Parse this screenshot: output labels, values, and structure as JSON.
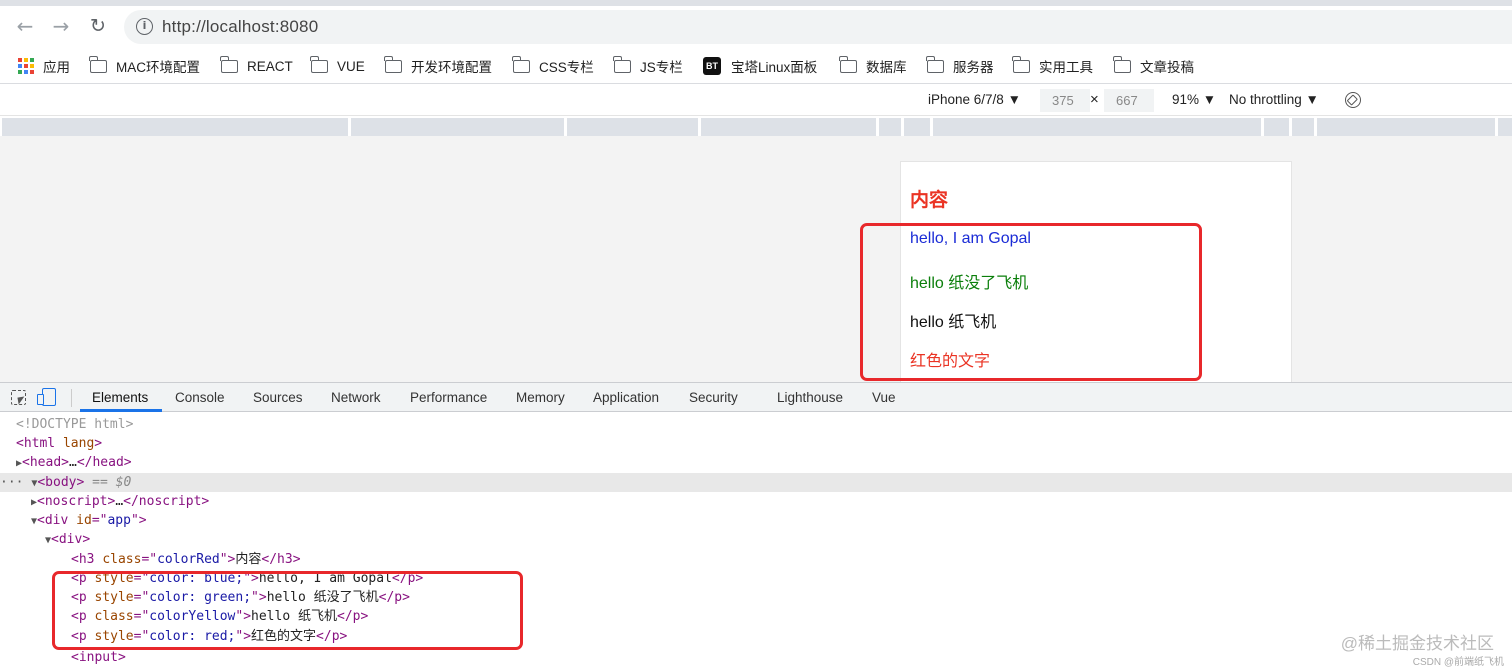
{
  "browser": {
    "url": "http://localhost:8080",
    "bookmarks": [
      {
        "label": "应用",
        "icon": "apps-grid-icon"
      },
      {
        "label": "MAC环境配置",
        "icon": "folder-icon"
      },
      {
        "label": "REACT",
        "icon": "folder-icon"
      },
      {
        "label": "VUE",
        "icon": "folder-icon"
      },
      {
        "label": "开发环境配置",
        "icon": "folder-icon"
      },
      {
        "label": "CSS专栏",
        "icon": "folder-icon"
      },
      {
        "label": "JS专栏",
        "icon": "folder-icon"
      },
      {
        "label": "宝塔Linux面板",
        "icon": "bt-icon",
        "badge": "BT"
      },
      {
        "label": "数据库",
        "icon": "folder-icon"
      },
      {
        "label": "服务器",
        "icon": "folder-icon"
      },
      {
        "label": "实用工具",
        "icon": "folder-icon"
      },
      {
        "label": "文章投稿",
        "icon": "folder-icon"
      }
    ]
  },
  "device_toolbar": {
    "device": "iPhone 6/7/8 ▼",
    "width": "375",
    "times": "×",
    "height": "667",
    "zoom": "91% ▼",
    "throttling": "No throttling ▼"
  },
  "page": {
    "heading": "内容",
    "paragraphs": [
      {
        "text": "hello, I am Gopal",
        "color": "#1a2bd6"
      },
      {
        "text": "hello 纸没了飞机",
        "color": "#0b7f0b"
      },
      {
        "text": "hello 纸飞机",
        "color": "#111111"
      },
      {
        "text": "红色的文字",
        "color": "#ea3323"
      }
    ]
  },
  "devtools": {
    "tabs": [
      "Elements",
      "Console",
      "Sources",
      "Network",
      "Performance",
      "Memory",
      "Application",
      "Security",
      "Lighthouse",
      "Vue"
    ],
    "active_tab": "Elements",
    "code": {
      "doctype": "<!DOCTYPE html>",
      "html_open": "<html lang>",
      "head": "<head>…</head>",
      "body": "<body>",
      "body_suffix": " == $0",
      "noscript": "<noscript>…</noscript>",
      "div_app": "<div id=\"app\">",
      "div": "<div>",
      "h3_text": "内容",
      "p1_text": "hello, I am Gopal",
      "p2_text": "hello 纸没了飞机",
      "p3_text": "hello 纸飞机",
      "p4_text": "红色的文字",
      "input": "<input>"
    }
  },
  "watermark": "@稀土掘金技术社区",
  "credit": "CSDN @前端纸飞机"
}
